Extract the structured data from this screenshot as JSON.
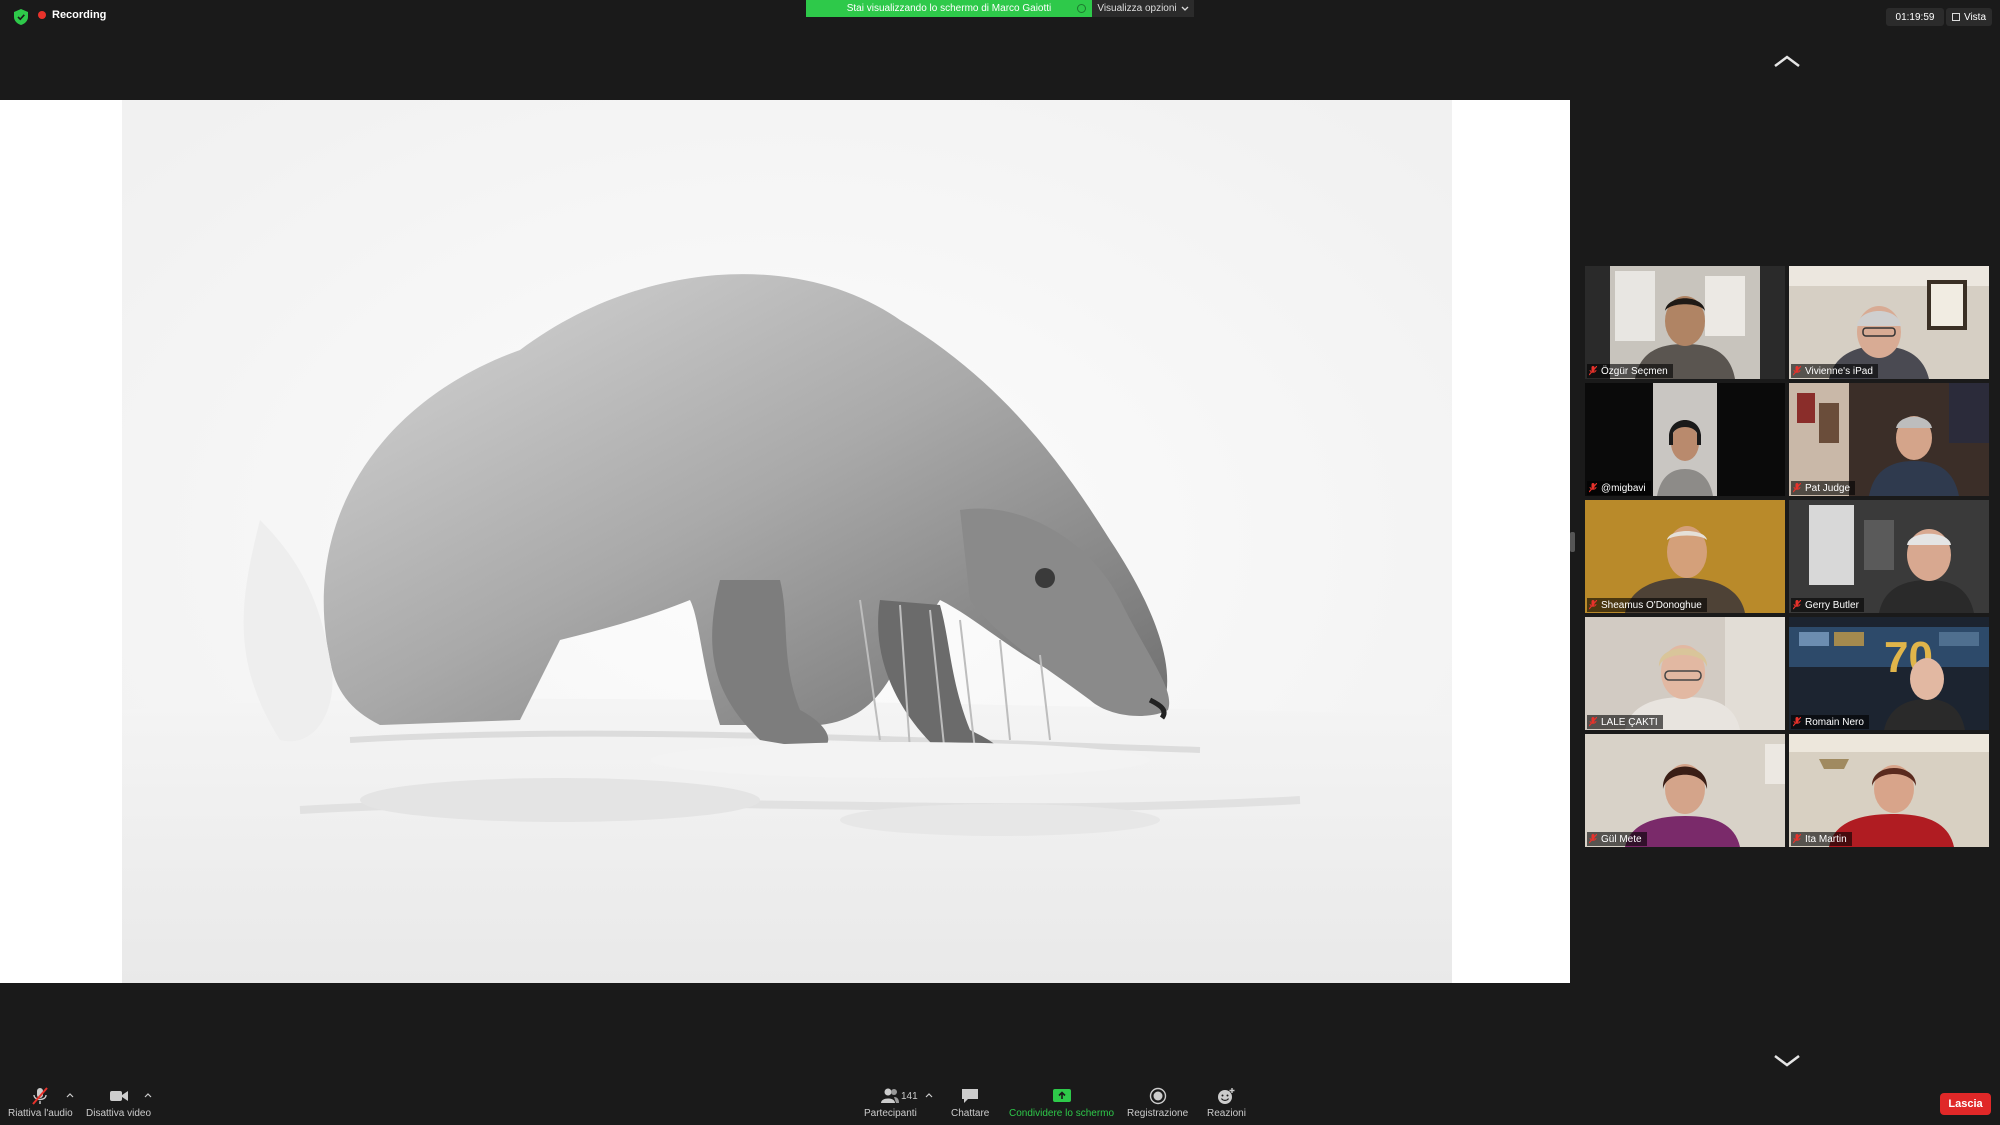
{
  "topbar": {
    "recording_label": "Recording",
    "share_banner": "Stai visualizzando lo schermo di Marco Gaiotti",
    "view_options": "Visualizza opzioni",
    "clock": "01:19:59",
    "view_label": "Vista"
  },
  "gallery": {
    "participants": [
      {
        "name": "Özgür Seçmen",
        "muted": true
      },
      {
        "name": "Vivienne's iPad",
        "muted": true
      },
      {
        "name": "@migbavi",
        "muted": true
      },
      {
        "name": "Pat Judge",
        "muted": true
      },
      {
        "name": "Sheamus O'Donoghue",
        "muted": true
      },
      {
        "name": "Gerry Butler",
        "muted": true
      },
      {
        "name": "LALE ÇAKTI",
        "muted": true
      },
      {
        "name": "Romain Nero",
        "muted": true
      },
      {
        "name": "Gül Mete",
        "muted": true
      },
      {
        "name": "Ita Martin",
        "muted": true
      }
    ]
  },
  "toolbar": {
    "unmute_label": "Riattiva l'audio",
    "stop_video_label": "Disattiva video",
    "participants_label": "Partecipanti",
    "participants_count": "141",
    "chat_label": "Chattare",
    "share_label": "Condividere lo schermo",
    "record_label": "Registrazione",
    "reactions_label": "Reazioni",
    "leave_label": "Lascia"
  },
  "colors": {
    "share_green": "#2ec94a",
    "recording_red": "#e8322b",
    "leave_red": "#e02828",
    "background": "#1a1a1a"
  }
}
